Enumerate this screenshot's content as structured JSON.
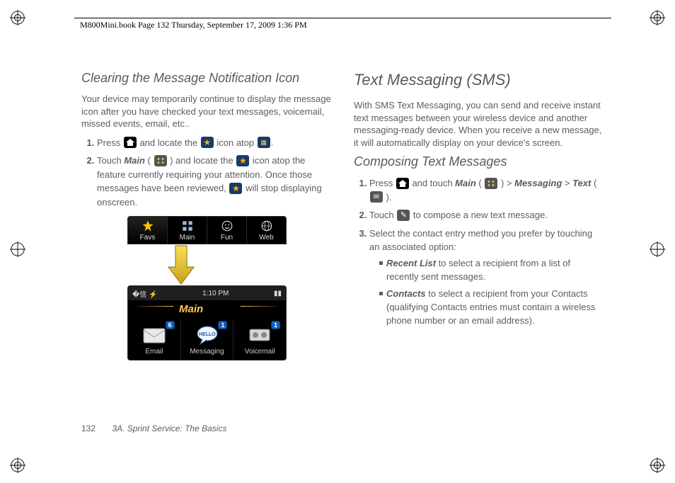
{
  "header": "M800Mini.book  Page 132  Thursday, September 17, 2009  1:36 PM",
  "left": {
    "heading": "Clearing the Message Notification Icon",
    "intro": "Your device may temporarily continue to display the message icon after you have checked your text messages, voicemail, missed events, email, etc..",
    "step1a": "Press ",
    "step1b": " and locate the ",
    "step1c": " icon atop ",
    "step1d": ".",
    "step2a": "Touch ",
    "step2b": "Main",
    "step2c": " ( ",
    "step2d": " ) and locate the ",
    "step2e": " icon atop the feature currently requiring your attention. Once those messages have been reviewed, ",
    "step2f": " will stop displaying onscreen.",
    "fig": {
      "tabs": [
        "Favs",
        "Main",
        "Fun",
        "Web"
      ],
      "status_left": "�信  ⚡",
      "status_time": "1:10 PM",
      "main_label": "Main",
      "apps": [
        {
          "label": "Email",
          "badge": "6"
        },
        {
          "label": "Messaging",
          "badge": "1"
        },
        {
          "label": "Voicemail",
          "badge": "1"
        }
      ]
    }
  },
  "right": {
    "h1": "Text Messaging (SMS)",
    "intro": "With SMS Text Messaging, you can send and receive instant text messages between your wireless device and another messaging-ready device. When you receive a new message, it will automatically display on your device's screen.",
    "h2": "Composing Text Messages",
    "step1a": "Press ",
    "step1b": " and touch ",
    "step1c": "Main",
    "step1d": " ( ",
    "step1e": " ) > ",
    "step1f": "Messaging",
    "step1g": " > ",
    "step1h": "Text",
    "step1i": " ( ",
    "step1j": " ).",
    "step2a": "Touch ",
    "step2b": " to compose a new text message.",
    "step3": "Select the contact entry method you prefer by touching an associated option:",
    "opt1a": "Recent List",
    "opt1b": " to select a recipient from a list of recently sent messages.",
    "opt2a": "Contacts",
    "opt2b": " to select a recipient from your Contacts (qualifying Contacts entries must contain a wireless phone number or an email address)."
  },
  "footer": {
    "page": "132",
    "section": "3A. Sprint Service: The Basics"
  }
}
